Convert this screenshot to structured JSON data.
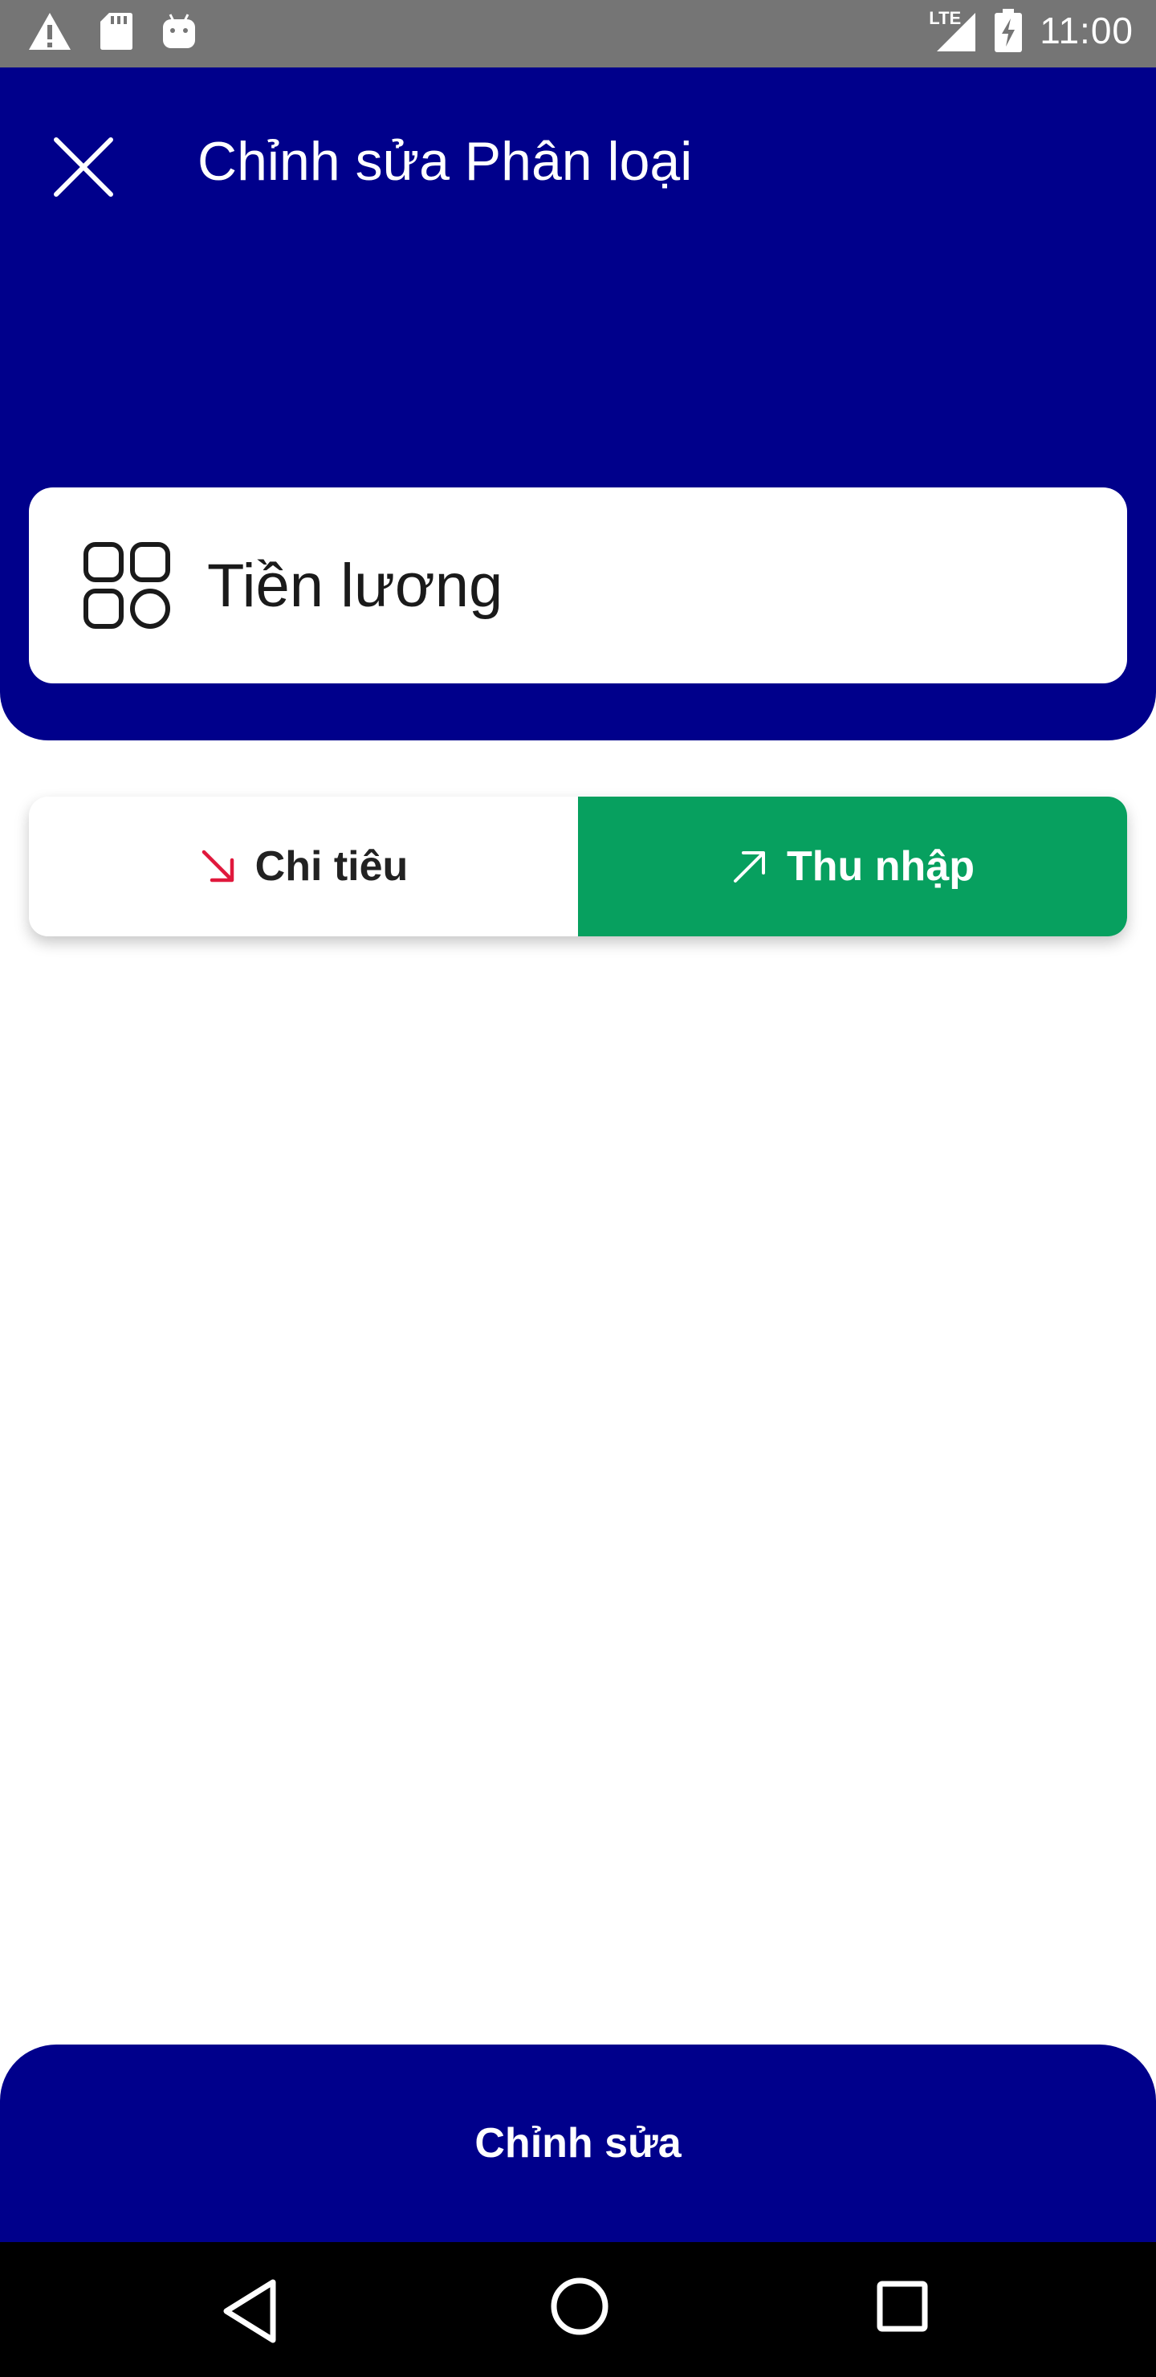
{
  "status_bar": {
    "time": "11:00",
    "network_label": "LTE",
    "icons": [
      "warning-icon",
      "sd-card-icon",
      "android-icon",
      "signal-icon",
      "battery-charging-icon"
    ]
  },
  "header": {
    "title": "Chỉnh sửa Phân loại",
    "close_icon": "close-icon"
  },
  "category": {
    "name_value": "Tiền lương",
    "icon": "category-grid-icon"
  },
  "type_toggle": {
    "expense_label": "Chi tiêu",
    "income_label": "Thu nhập",
    "selected": "income",
    "expense_arrow_color": "#e0183c",
    "income_color": "#07a05f"
  },
  "action": {
    "label": "Chỉnh sửa"
  },
  "colors": {
    "primary": "#00008b",
    "status_bar": "#757575",
    "nav_bar": "#000000"
  },
  "nav_bar": {
    "icons": [
      "back-icon",
      "home-icon",
      "recents-icon"
    ]
  }
}
